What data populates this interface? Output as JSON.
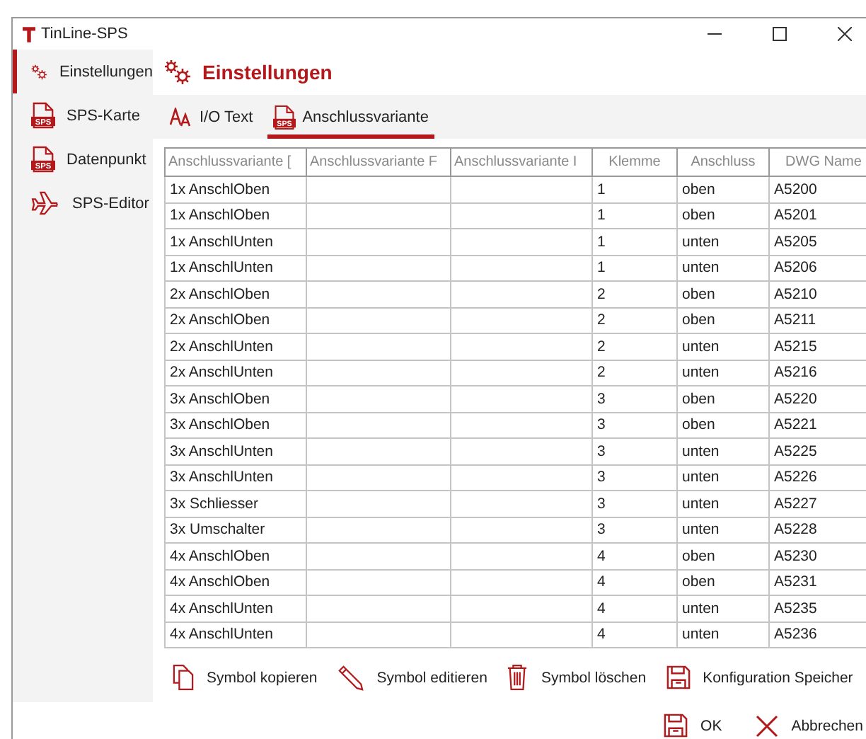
{
  "window": {
    "title": "TinLine-SPS"
  },
  "sidebar": {
    "items": [
      {
        "label": "Einstellungen",
        "selected": true
      },
      {
        "label": "SPS-Karte",
        "icon_badge": "SPS",
        "selected": false
      },
      {
        "label": "Datenpunkt",
        "icon_badge": "SPS",
        "selected": false
      },
      {
        "label": "SPS-Editor",
        "selected": false
      }
    ]
  },
  "page_title": "Einstellungen",
  "tabs": [
    {
      "label": "I/O Text",
      "selected": false
    },
    {
      "label": "Anschlussvariante",
      "icon_badge": "SPS",
      "selected": true
    }
  ],
  "table": {
    "columns": [
      "Anschlussvariante [",
      "Anschlussvariante F",
      "Anschlussvariante I",
      "Klemme",
      "Anschluss",
      "DWG Name"
    ],
    "rows": [
      [
        "1x AnschlOben",
        "",
        "",
        "1",
        "oben",
        "A5200"
      ],
      [
        "1x AnschlOben",
        "",
        "",
        "1",
        "oben",
        "A5201"
      ],
      [
        "1x AnschlUnten",
        "",
        "",
        "1",
        "unten",
        "A5205"
      ],
      [
        "1x AnschlUnten",
        "",
        "",
        "1",
        "unten",
        "A5206"
      ],
      [
        "2x AnschlOben",
        "",
        "",
        "2",
        "oben",
        "A5210"
      ],
      [
        "2x AnschlOben",
        "",
        "",
        "2",
        "oben",
        "A5211"
      ],
      [
        "2x AnschlUnten",
        "",
        "",
        "2",
        "unten",
        "A5215"
      ],
      [
        "2x AnschlUnten",
        "",
        "",
        "2",
        "unten",
        "A5216"
      ],
      [
        "3x AnschlOben",
        "",
        "",
        "3",
        "oben",
        "A5220"
      ],
      [
        "3x AnschlOben",
        "",
        "",
        "3",
        "oben",
        "A5221"
      ],
      [
        "3x AnschlUnten",
        "",
        "",
        "3",
        "unten",
        "A5225"
      ],
      [
        "3x AnschlUnten",
        "",
        "",
        "3",
        "unten",
        "A5226"
      ],
      [
        "3x Schliesser",
        "",
        "",
        "3",
        "unten",
        "A5227"
      ],
      [
        "3x Umschalter",
        "",
        "",
        "3",
        "unten",
        "A5228"
      ],
      [
        "4x AnschlOben",
        "",
        "",
        "4",
        "oben",
        "A5230"
      ],
      [
        "4x AnschlOben",
        "",
        "",
        "4",
        "oben",
        "A5231"
      ],
      [
        "4x AnschlUnten",
        "",
        "",
        "4",
        "unten",
        "A5235"
      ],
      [
        "4x AnschlUnten",
        "",
        "",
        "4",
        "unten",
        "A5236"
      ]
    ]
  },
  "actions": [
    "Symbol kopieren",
    "Symbol editieren",
    "Symbol löschen",
    "Konfiguration Speicher"
  ],
  "dialog_buttons": [
    "OK",
    "Abbrechen"
  ]
}
